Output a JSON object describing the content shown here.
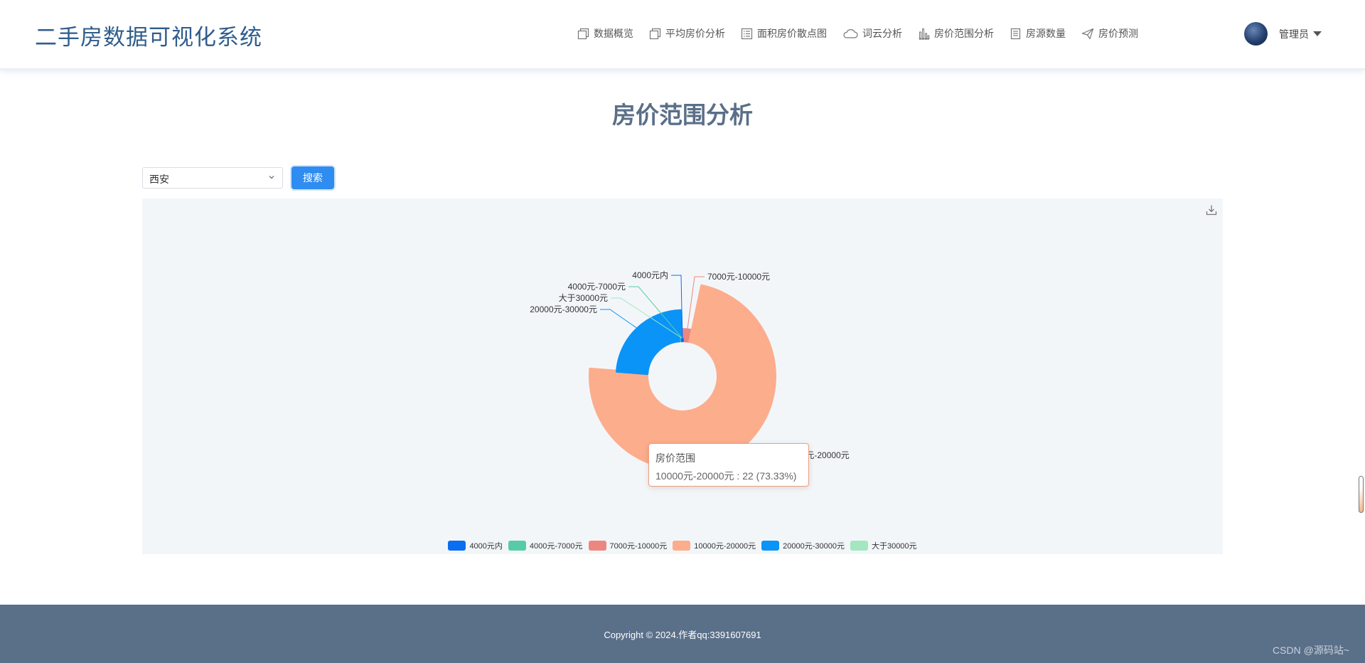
{
  "app": {
    "title": "二手房数据可视化系统"
  },
  "nav": {
    "items": [
      {
        "label": "数据概览",
        "icon": "copy-icon"
      },
      {
        "label": "平均房价分析",
        "icon": "copy-icon"
      },
      {
        "label": "面积房价散点图",
        "icon": "list-icon"
      },
      {
        "label": "词云分析",
        "icon": "cloud-icon"
      },
      {
        "label": "房价范围分析",
        "icon": "bar-chart-icon"
      },
      {
        "label": "房源数量",
        "icon": "document-icon"
      },
      {
        "label": "房价预测",
        "icon": "send-icon"
      }
    ]
  },
  "user": {
    "name": "管理员"
  },
  "main": {
    "title": "房价范围分析",
    "city_select": {
      "value": "西安"
    },
    "search_label": "搜索"
  },
  "chart_data": {
    "type": "pie",
    "series_name": "房价范围",
    "categories": [
      "4000元内",
      "4000元-7000元",
      "7000元-10000元",
      "10000元-20000元",
      "20000元-30000元",
      "大于30000元"
    ],
    "values": [
      0,
      0,
      1,
      22,
      7,
      0
    ],
    "colors": [
      "#0b6df0",
      "#56cca6",
      "#ec8780",
      "#fcad8c",
      "#0a94f7",
      "#a3e6c0"
    ],
    "rose_type": "radius",
    "legend_position": "bottom"
  },
  "tooltip": {
    "title": "房价范围",
    "text": "10000元-20000元 : 22 (73.33%)"
  },
  "footer": {
    "copyright": "Copyright © 2024.作者qq:3391607691",
    "watermark": "CSDN @源码站~"
  }
}
